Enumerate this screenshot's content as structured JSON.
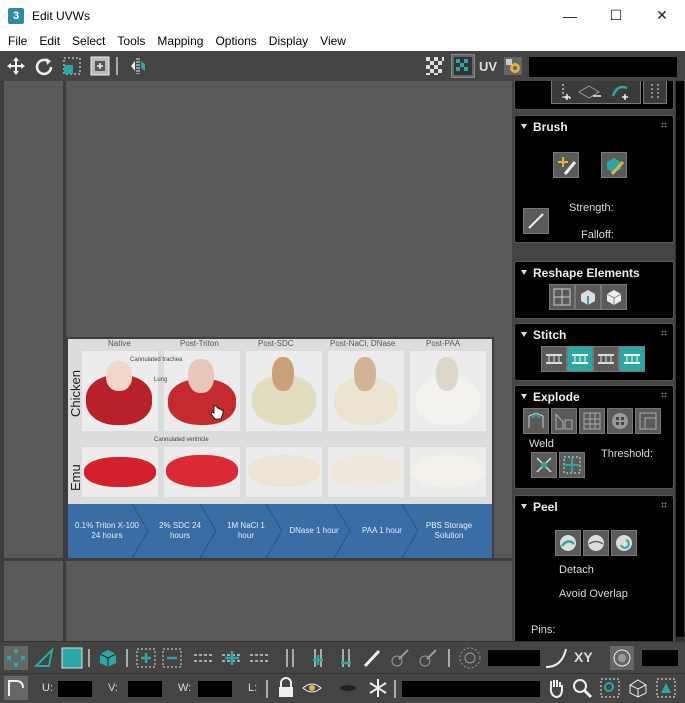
{
  "window": {
    "title": "Edit UVWs",
    "app_icon_text": "3",
    "minimize": "—",
    "maximize": "☐",
    "close": "✕"
  },
  "menu": [
    "File",
    "Edit",
    "Select",
    "Tools",
    "Mapping",
    "Options",
    "Display",
    "View"
  ],
  "toolbar_top": {
    "uv_label": "UV"
  },
  "texture": {
    "column_headers": [
      "Native",
      "Post-Triton",
      "Post-SDC",
      "Post-NaCl, DNase",
      "Post-PAA"
    ],
    "row_labels": [
      "Chicken",
      "Emu"
    ],
    "annotations": [
      "Cannulated trachea",
      "Lung",
      "Cannulated ventricle"
    ],
    "steps": [
      "0.1% Triton X-100 24 hours",
      "2% SDC 24 hours",
      "1M NaCl 1 hour",
      "DNase 1 hour",
      "PAA 1 hour",
      "PBS Storage Solution"
    ]
  },
  "panel": {
    "brush": {
      "title": "Brush",
      "strength": "Strength:",
      "falloff": "Falloff:"
    },
    "reshape": {
      "title": "Reshape Elements"
    },
    "stitch": {
      "title": "Stitch"
    },
    "explode": {
      "title": "Explode",
      "weld": "Weld",
      "threshold": "Threshold:"
    },
    "peel": {
      "title": "Peel",
      "detach": "Detach",
      "avoid_overlap": "Avoid Overlap",
      "pins": "Pins:"
    }
  },
  "bottom": {
    "xy_label": "XY",
    "u_label": "U:",
    "v_label": "V:",
    "w_label": "W:",
    "l_label": "L:"
  },
  "colors": {
    "teal": "#2aa7a7",
    "viewport": "#595959",
    "panel_bg": "#000000",
    "chrome": "#444444",
    "arrow_band": "#3a6da4"
  }
}
